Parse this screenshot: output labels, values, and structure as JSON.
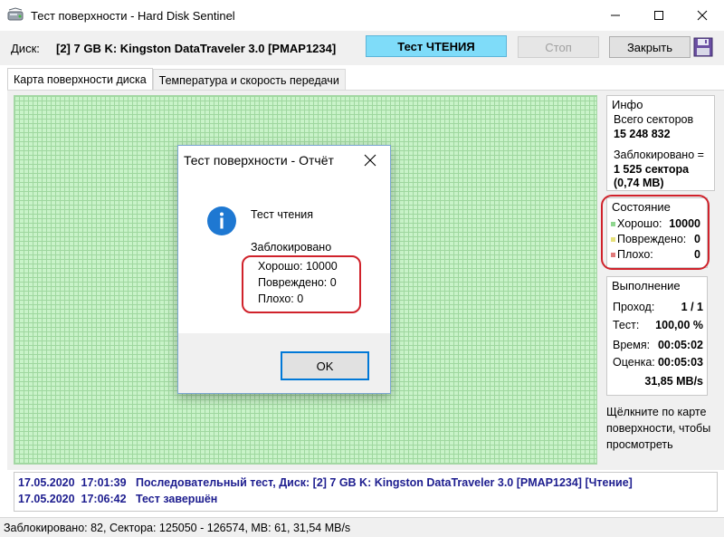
{
  "window": {
    "title": "Тест поверхности - Hard Disk Sentinel"
  },
  "toolbar": {
    "disk_label": "Диск:",
    "disk_value": "[2] 7 GB K: Kingston DataTraveler 3.0 [PMAP1234]",
    "test_button": "Тест ЧТЕНИЯ",
    "stop_button": "Стоп",
    "close_button": "Закрыть"
  },
  "tabs": [
    {
      "label": "Карта поверхности диска",
      "active": true
    },
    {
      "label": "Температура и скорость передачи",
      "active": false
    }
  ],
  "info": {
    "title": "Инфо",
    "total_label": "Всего секторов",
    "total_value": "15 248 832",
    "blocked_label": "Заблокировано =",
    "blocked_sectors": "1 525 сектора",
    "blocked_mb": "(0,74 MB)"
  },
  "state": {
    "title": "Состояние",
    "good_label": "Хорошо:",
    "good_value": "10000",
    "damaged_label": "Повреждено:",
    "damaged_value": "0",
    "bad_label": "Плохо:",
    "bad_value": "0",
    "colors": {
      "good": "#8fd68f",
      "damaged": "#e6e07a",
      "bad": "#e07a7a"
    }
  },
  "execution": {
    "title": "Выполнение",
    "rows": [
      {
        "label": "Проход:",
        "value": "1 / 1"
      },
      {
        "label": "Тест:",
        "value": "100,00 %"
      },
      {
        "label": "Время:",
        "value": "00:05:02"
      },
      {
        "label": "Оценка:",
        "value": "00:05:03"
      }
    ],
    "speed": "31,85 MB/s"
  },
  "hint": "Щёлкните по карте поверхности, чтобы просмотреть",
  "dialog": {
    "title": "Тест поверхности - Отчёт",
    "line1": "Тест чтения",
    "line2": "Заблокировано",
    "line3": "Хорошо: 10000",
    "line4": "Повреждено: 0",
    "line5": "Плохо: 0",
    "ok_button": "OK"
  },
  "log": [
    {
      "date": "17.05.2020",
      "time": "17:01:39",
      "text": "Последовательный тест, Диск: [2] 7 GB K: Kingston DataTraveler 3.0 [PMAP1234] [Чтение]"
    },
    {
      "date": "17.05.2020",
      "time": "17:06:42",
      "text": "Тест завершён"
    }
  ],
  "status_bar": "Заблокировано: 82, Сектора: 125050 - 126574, MB: 61, 31,54 MB/s"
}
